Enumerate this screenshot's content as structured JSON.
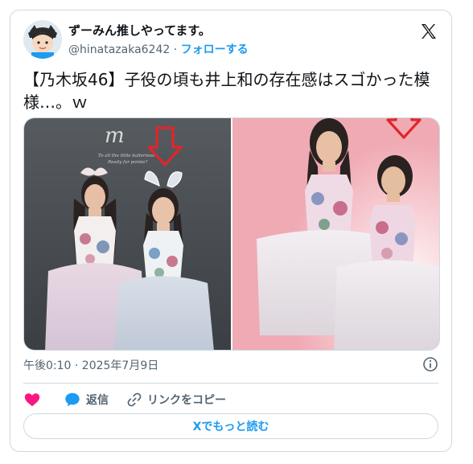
{
  "author": {
    "display_name": "ずーみん推しやってます。",
    "handle": "@hinatazaka6242",
    "separator": "·",
    "follow_label": "フォローする"
  },
  "tweet": {
    "text": "【乃木坂46】子役の頃も井上和の存在感はスゴかった模様…。ｗ",
    "timestamp": "午後0:10 · 2025年7月9日"
  },
  "media": {
    "left_image_text": {
      "logo": "m",
      "caption_line1": "To all the little ballerinas",
      "caption_line2": "Ready for pointe?"
    }
  },
  "actions": {
    "reply_label": "返信",
    "copy_link_label": "リンクをコピー"
  },
  "read_more_label": "Xでもっと読む",
  "colors": {
    "accent": "#1d9bf0",
    "like": "#f91880",
    "text": "#0f1419",
    "secondary": "#536471",
    "border": "#cfd9de",
    "arrow": "#e0262b"
  },
  "icons": [
    "x-logo-icon",
    "info-icon",
    "heart-icon",
    "reply-bubble-icon",
    "link-icon",
    "down-arrow-icon"
  ]
}
